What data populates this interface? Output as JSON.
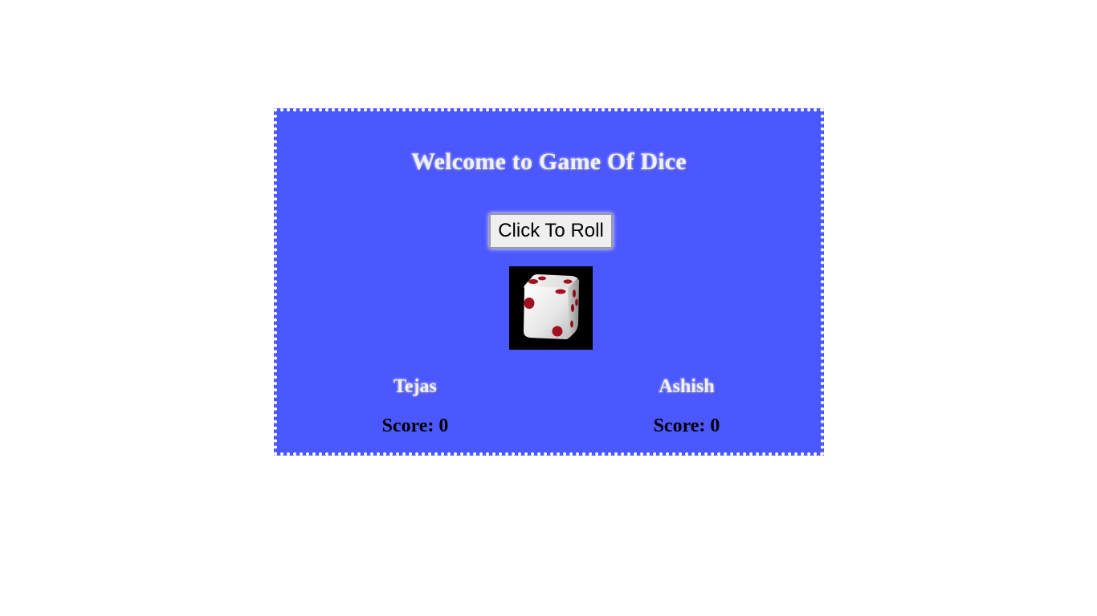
{
  "game": {
    "title": "Welcome to Game Of Dice",
    "roll_button_label": "Click To Roll",
    "dice": {
      "icon": "dice-icon",
      "face_value": 4,
      "background_color": "#000000",
      "pip_color": "#a01020"
    },
    "panel_color": "#4b57ff",
    "players": [
      {
        "name": "Tejas",
        "score_text": "Score: 0"
      },
      {
        "name": "Ashish",
        "score_text": "Score: 0"
      }
    ]
  }
}
